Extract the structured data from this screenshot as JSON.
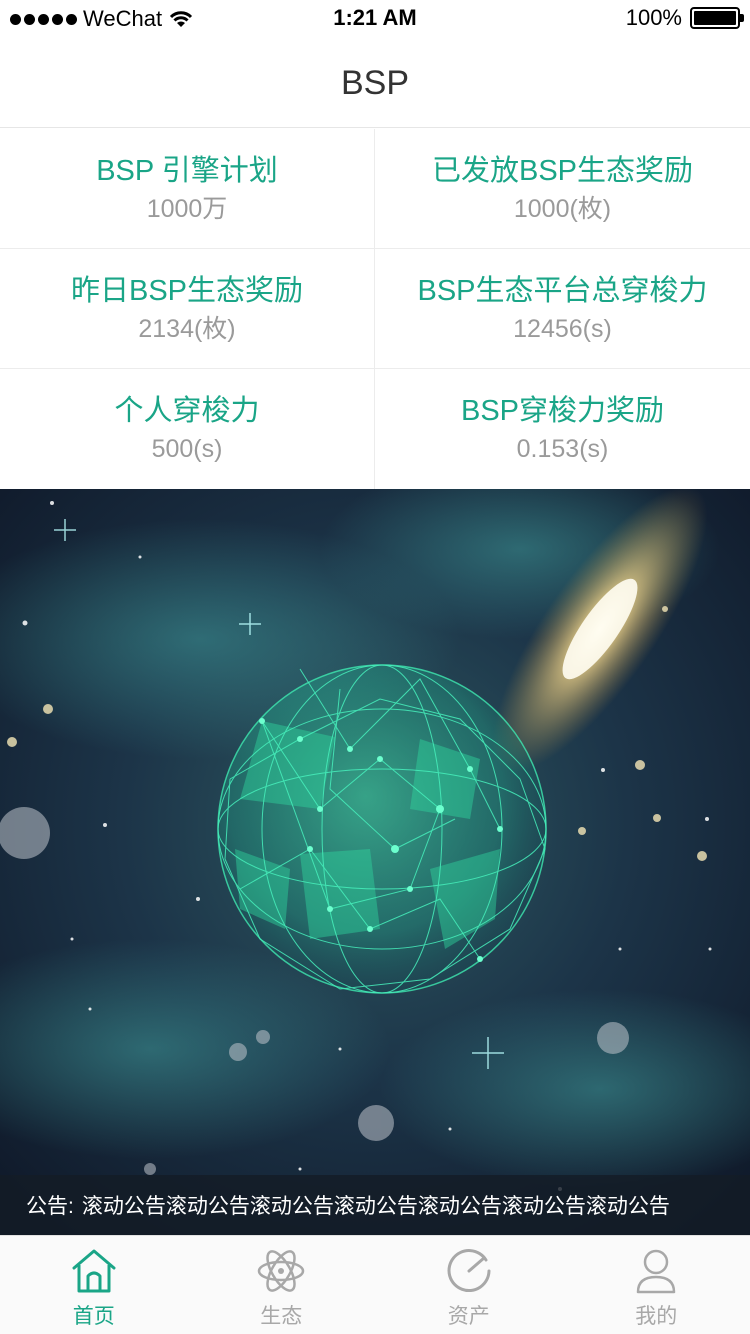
{
  "status_bar": {
    "carrier": "WeChat",
    "time": "1:21 AM",
    "battery": "100%"
  },
  "nav": {
    "title": "BSP"
  },
  "stats": [
    {
      "label": "BSP 引擎计划",
      "value": "1000万"
    },
    {
      "label": "已发放BSP生态奖励",
      "value": "1000(枚)"
    },
    {
      "label": "昨日BSP生态奖励",
      "value": "2134(枚)"
    },
    {
      "label": "BSP生态平台总穿梭力",
      "value": "12456(s)"
    },
    {
      "label": "个人穿梭力",
      "value": "500(s)"
    },
    {
      "label": "BSP穿梭力奖励",
      "value": "0.153(s)"
    }
  ],
  "notice": {
    "prefix": "公告:",
    "text": "滚动公告滚动公告滚动公告滚动公告滚动公告滚动公告滚动公告"
  },
  "tabs": [
    {
      "label": "首页",
      "icon": "home-icon",
      "active": true
    },
    {
      "label": "生态",
      "icon": "atom-icon",
      "active": false
    },
    {
      "label": "资产",
      "icon": "assets-icon",
      "active": false
    },
    {
      "label": "我的",
      "icon": "profile-icon",
      "active": false
    }
  ],
  "colors": {
    "accent": "#1aa587",
    "muted_text": "#9a9a9a",
    "tab_inactive": "#a8a8a8"
  }
}
